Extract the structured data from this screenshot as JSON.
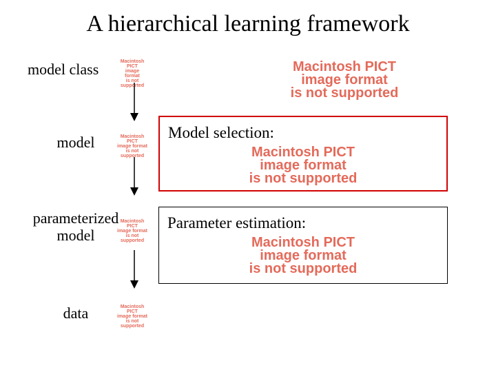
{
  "title": "A hierarchical learning framework",
  "levels": {
    "l1": "model class",
    "l2": "model",
    "l3": "parameterized\nmodel",
    "l4": "data"
  },
  "boxes": {
    "selection": "Model selection:",
    "estimation": "Parameter estimation:"
  },
  "pict": {
    "line1": "Macintosh PICT",
    "line2": "image format",
    "line3": "is not supported"
  }
}
